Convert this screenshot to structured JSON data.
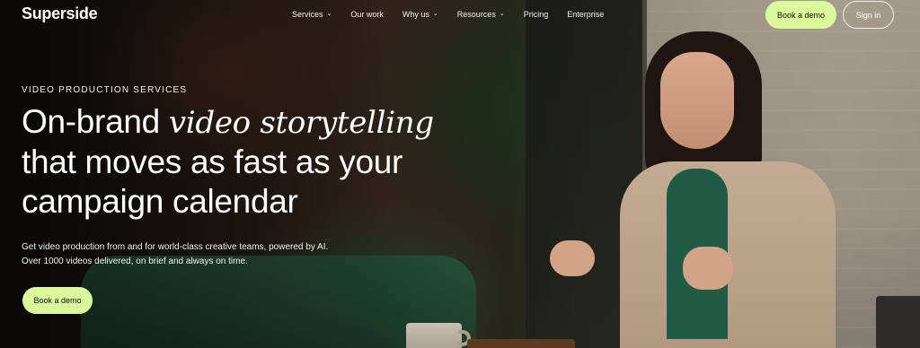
{
  "header": {
    "logo": "Superside",
    "nav": [
      {
        "label": "Services",
        "has_dropdown": true
      },
      {
        "label": "Our work",
        "has_dropdown": false
      },
      {
        "label": "Why us",
        "has_dropdown": true
      },
      {
        "label": "Resources",
        "has_dropdown": true
      },
      {
        "label": "Pricing",
        "has_dropdown": false
      },
      {
        "label": "Enterprise",
        "has_dropdown": false
      }
    ],
    "book_demo_label": "Book a demo",
    "sign_in_label": "Sign in",
    "chevron_icon": "chevron-down-icon"
  },
  "hero": {
    "eyebrow": "VIDEO PRODUCTION SERVICES",
    "headline_part1": "On-brand ",
    "headline_italic": "video storytelling",
    "headline_line2": "that moves as fast as your",
    "headline_line3": "campaign calendar",
    "subtext_line1": "Get video production from and for world-class creative teams, powered by AI.",
    "subtext_line2": "Over 1000 videos delivered, on brief and always on time.",
    "cta_label": "Book a demo"
  },
  "colors": {
    "accent": "#d9f99a",
    "text": "#ffffff"
  }
}
